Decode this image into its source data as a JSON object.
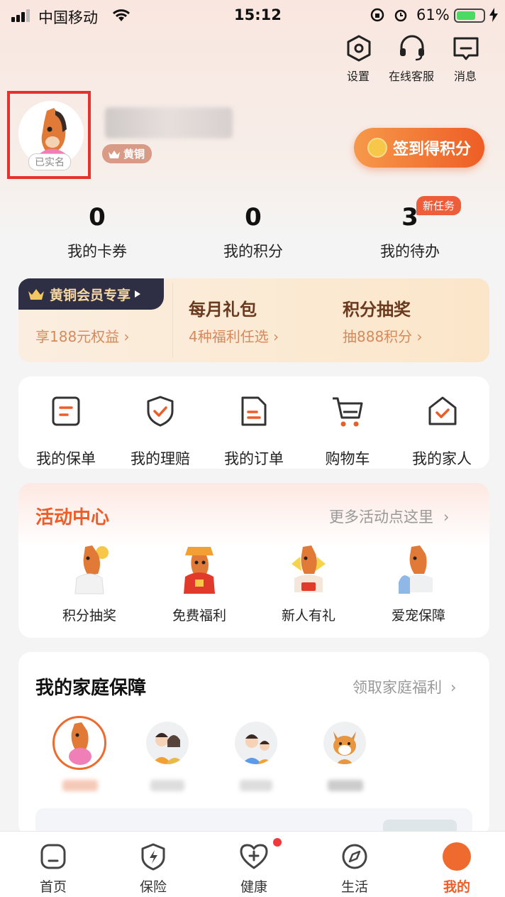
{
  "status_bar": {
    "carrier": "中国移动",
    "time": "15:12",
    "battery": "61%"
  },
  "top_icons": [
    {
      "label": "设置",
      "icon": "settings-hexagon-icon"
    },
    {
      "label": "在线客服",
      "icon": "headset-icon"
    },
    {
      "label": "消息",
      "icon": "message-icon"
    }
  ],
  "profile": {
    "verify_status": "已实名",
    "tier": "黄铜",
    "checkin_label": "签到得积分"
  },
  "stats": [
    {
      "value": "0",
      "label": "我的卡券"
    },
    {
      "value": "0",
      "label": "我的积分"
    },
    {
      "value": "3",
      "label": "我的待办",
      "badge": "新任务"
    }
  ],
  "member": {
    "tag": "黄铜会员专享",
    "tag_sub": "享188元权益",
    "items": [
      {
        "title": "每月礼包",
        "sub": "4种福利任选"
      },
      {
        "title": "积分抽奖",
        "sub": "抽888积分"
      }
    ]
  },
  "quick_actions": [
    {
      "label": "我的保单"
    },
    {
      "label": "我的理赔"
    },
    {
      "label": "我的订单"
    },
    {
      "label": "购物车"
    },
    {
      "label": "我的家人"
    }
  ],
  "activity": {
    "title": "活动中心",
    "more": "更多活动点这里",
    "items": [
      {
        "label": "积分抽奖"
      },
      {
        "label": "免费福利"
      },
      {
        "label": "新人有礼"
      },
      {
        "label": "爱宠保障"
      }
    ]
  },
  "family": {
    "title": "我的家庭保障",
    "more": "领取家庭福利"
  },
  "nav": [
    {
      "label": "首页"
    },
    {
      "label": "保险"
    },
    {
      "label": "健康"
    },
    {
      "label": "生活"
    },
    {
      "label": "我的"
    }
  ],
  "colors": {
    "accent": "#ee5d25",
    "highlight_box": "#e5322d",
    "member_dark": "#2e2f45"
  }
}
